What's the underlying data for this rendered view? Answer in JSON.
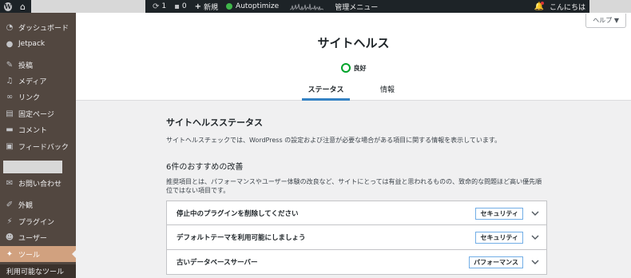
{
  "adminbar": {
    "updates_count": "1",
    "comments_count": "0",
    "new_label": "新規",
    "autoptimize_label": "Autoptimize",
    "manage_menu_label": "管理メニュー",
    "greeting": "こんにちは"
  },
  "sidebar": {
    "items": [
      {
        "label": "ダッシュボード",
        "icon": "dashboard-icon"
      },
      {
        "label": "Jetpack",
        "icon": "jetpack-icon"
      },
      {
        "label": "投稿",
        "icon": "pin-icon"
      },
      {
        "label": "メディア",
        "icon": "media-icon"
      },
      {
        "label": "リンク",
        "icon": "link-icon"
      },
      {
        "label": "固定ページ",
        "icon": "page-icon"
      },
      {
        "label": "コメント",
        "icon": "comment-icon"
      },
      {
        "label": "フィードバック",
        "icon": "feedback-icon"
      },
      {
        "label": "お問い合わせ",
        "icon": "mail-icon"
      },
      {
        "label": "外観",
        "icon": "brush-icon"
      },
      {
        "label": "プラグイン",
        "icon": "plugin-icon"
      },
      {
        "label": "ユーザー",
        "icon": "user-icon"
      },
      {
        "label": "ツール",
        "icon": "wrench-icon"
      }
    ],
    "submenu_label": "利用可能なツール"
  },
  "header": {
    "help_label": "ヘルプ ▼",
    "title": "サイトヘルス",
    "status_label": "良好",
    "tabs": [
      {
        "label": "ステータス"
      },
      {
        "label": "情報"
      }
    ]
  },
  "main": {
    "heading": "サイトヘルスステータス",
    "description": "サイトヘルスチェックでは、WordPress の設定および注意が必要な場合がある項目に関する情報を表示しています。",
    "recommended_heading": "6件のおすすめの改善",
    "recommended_description": "推奨項目とは、パフォーマンスやユーザー体験の改良など、サイトにとっては有益と思われるものの、致命的な問題ほど高い優先順位ではない項目です。",
    "items": [
      {
        "title": "停止中のプラグインを削除してください",
        "badge": "セキュリティ"
      },
      {
        "title": "デフォルトテーマを利用可能にしましょう",
        "badge": "セキュリティ"
      },
      {
        "title": "古いデータベースサーバー",
        "badge": "パフォーマンス"
      }
    ]
  },
  "colors": {
    "adminbar_bg": "#1d2327",
    "sidebar_bg": "#524740",
    "active_menu": "#d1a17f",
    "good_status": "#00a32a",
    "tab_underline": "#3582c4",
    "badge_border": "#72aee6"
  }
}
